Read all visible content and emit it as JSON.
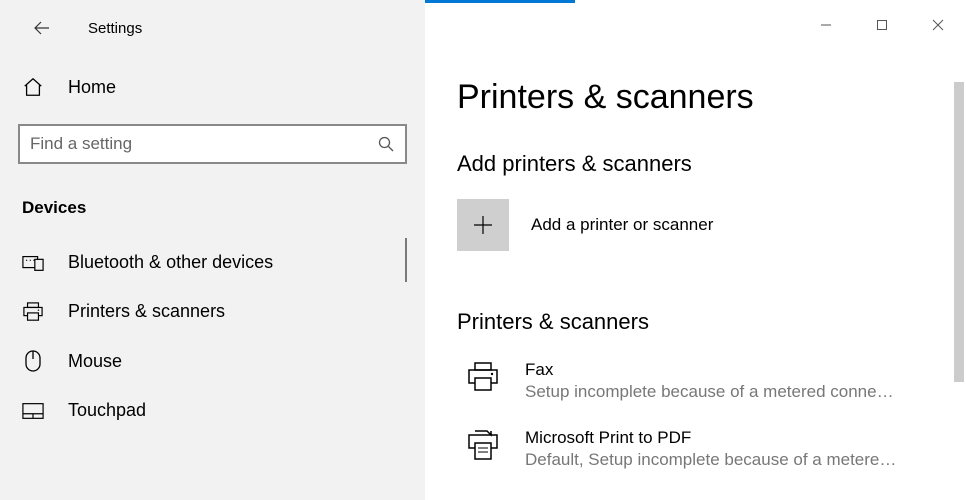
{
  "titlebar": {
    "title": "Settings"
  },
  "sidebar": {
    "home_label": "Home",
    "search_placeholder": "Find a setting",
    "section_header": "Devices",
    "items": [
      {
        "label": "Bluetooth & other devices"
      },
      {
        "label": "Printers & scanners"
      },
      {
        "label": "Mouse"
      },
      {
        "label": "Touchpad"
      }
    ]
  },
  "main": {
    "page_title": "Printers & scanners",
    "add_section_title": "Add printers & scanners",
    "add_label": "Add a printer or scanner",
    "list_section_title": "Printers & scanners",
    "printers": [
      {
        "name": "Fax",
        "status": "Setup incomplete because of a metered conne…"
      },
      {
        "name": "Microsoft Print to PDF",
        "status": "Default, Setup incomplete because of a metere…"
      }
    ]
  }
}
